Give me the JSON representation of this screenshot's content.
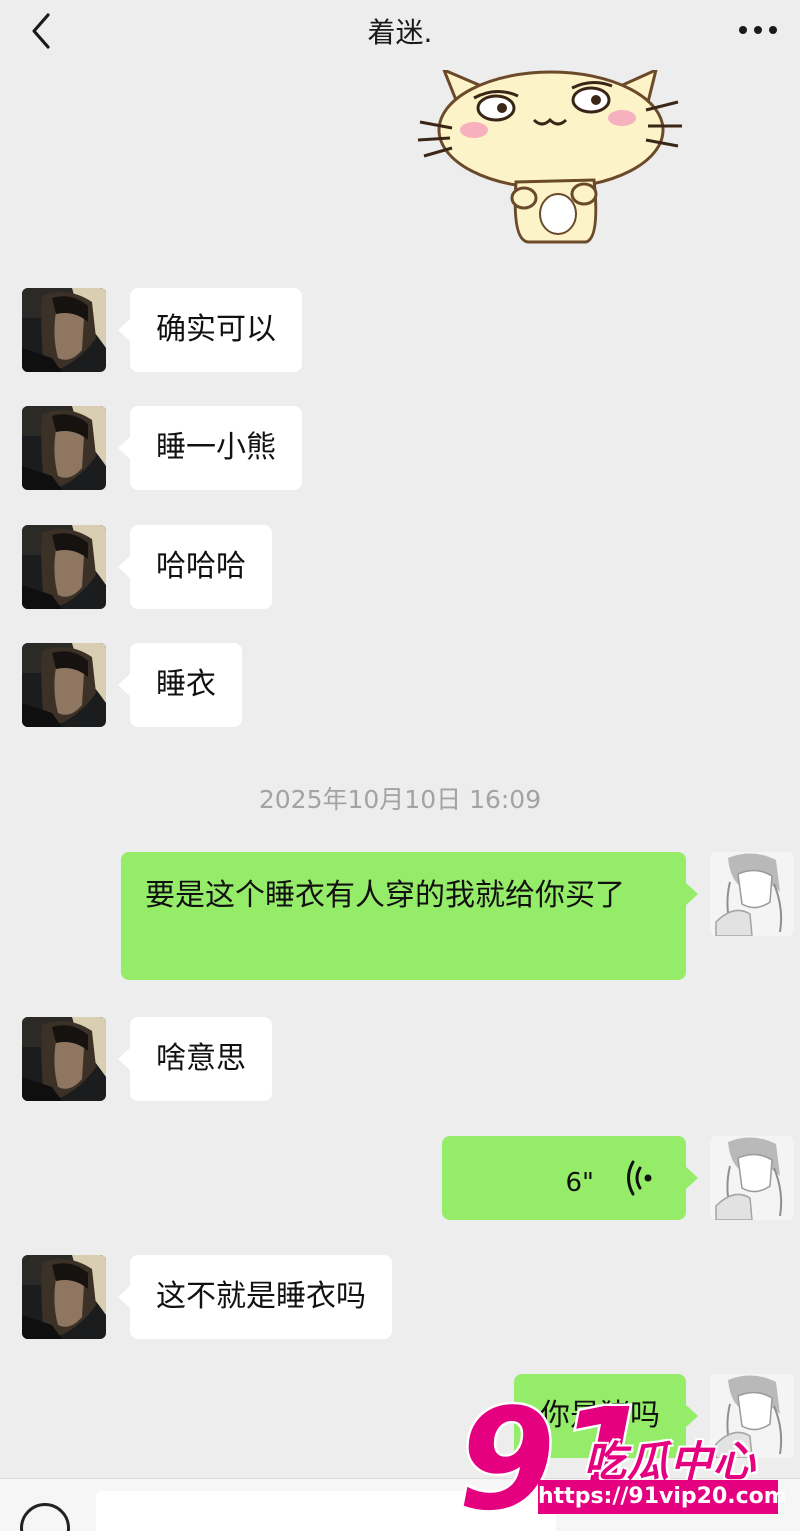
{
  "header": {
    "title": "着迷.",
    "back_icon": "chevron-left-icon",
    "more_icon": "more-dots-icon"
  },
  "messages_before": [
    {
      "sender": "contact",
      "text": "确实可以"
    },
    {
      "sender": "contact",
      "text": "睡一小熊"
    },
    {
      "sender": "contact",
      "text": "哈哈哈"
    },
    {
      "sender": "contact",
      "text": "睡衣"
    }
  ],
  "timestamp": "2025年10月10日 16:09",
  "messages_after": [
    {
      "sender": "me",
      "text": "要是这个睡衣有人穿的我就给你买了"
    },
    {
      "sender": "contact",
      "text": "啥意思"
    },
    {
      "sender": "me",
      "type": "voice",
      "duration": "6\""
    },
    {
      "sender": "contact",
      "text": "这不就是睡衣吗"
    },
    {
      "sender": "me",
      "text": "你是猪吗"
    }
  ],
  "watermark": {
    "logo_text": "91吃瓜中心",
    "url": "https://91vip20.com"
  },
  "colors": {
    "background": "#ededed",
    "outgoing_bubble": "#95ec69",
    "incoming_bubble": "#ffffff",
    "watermark": "#e4007f"
  }
}
